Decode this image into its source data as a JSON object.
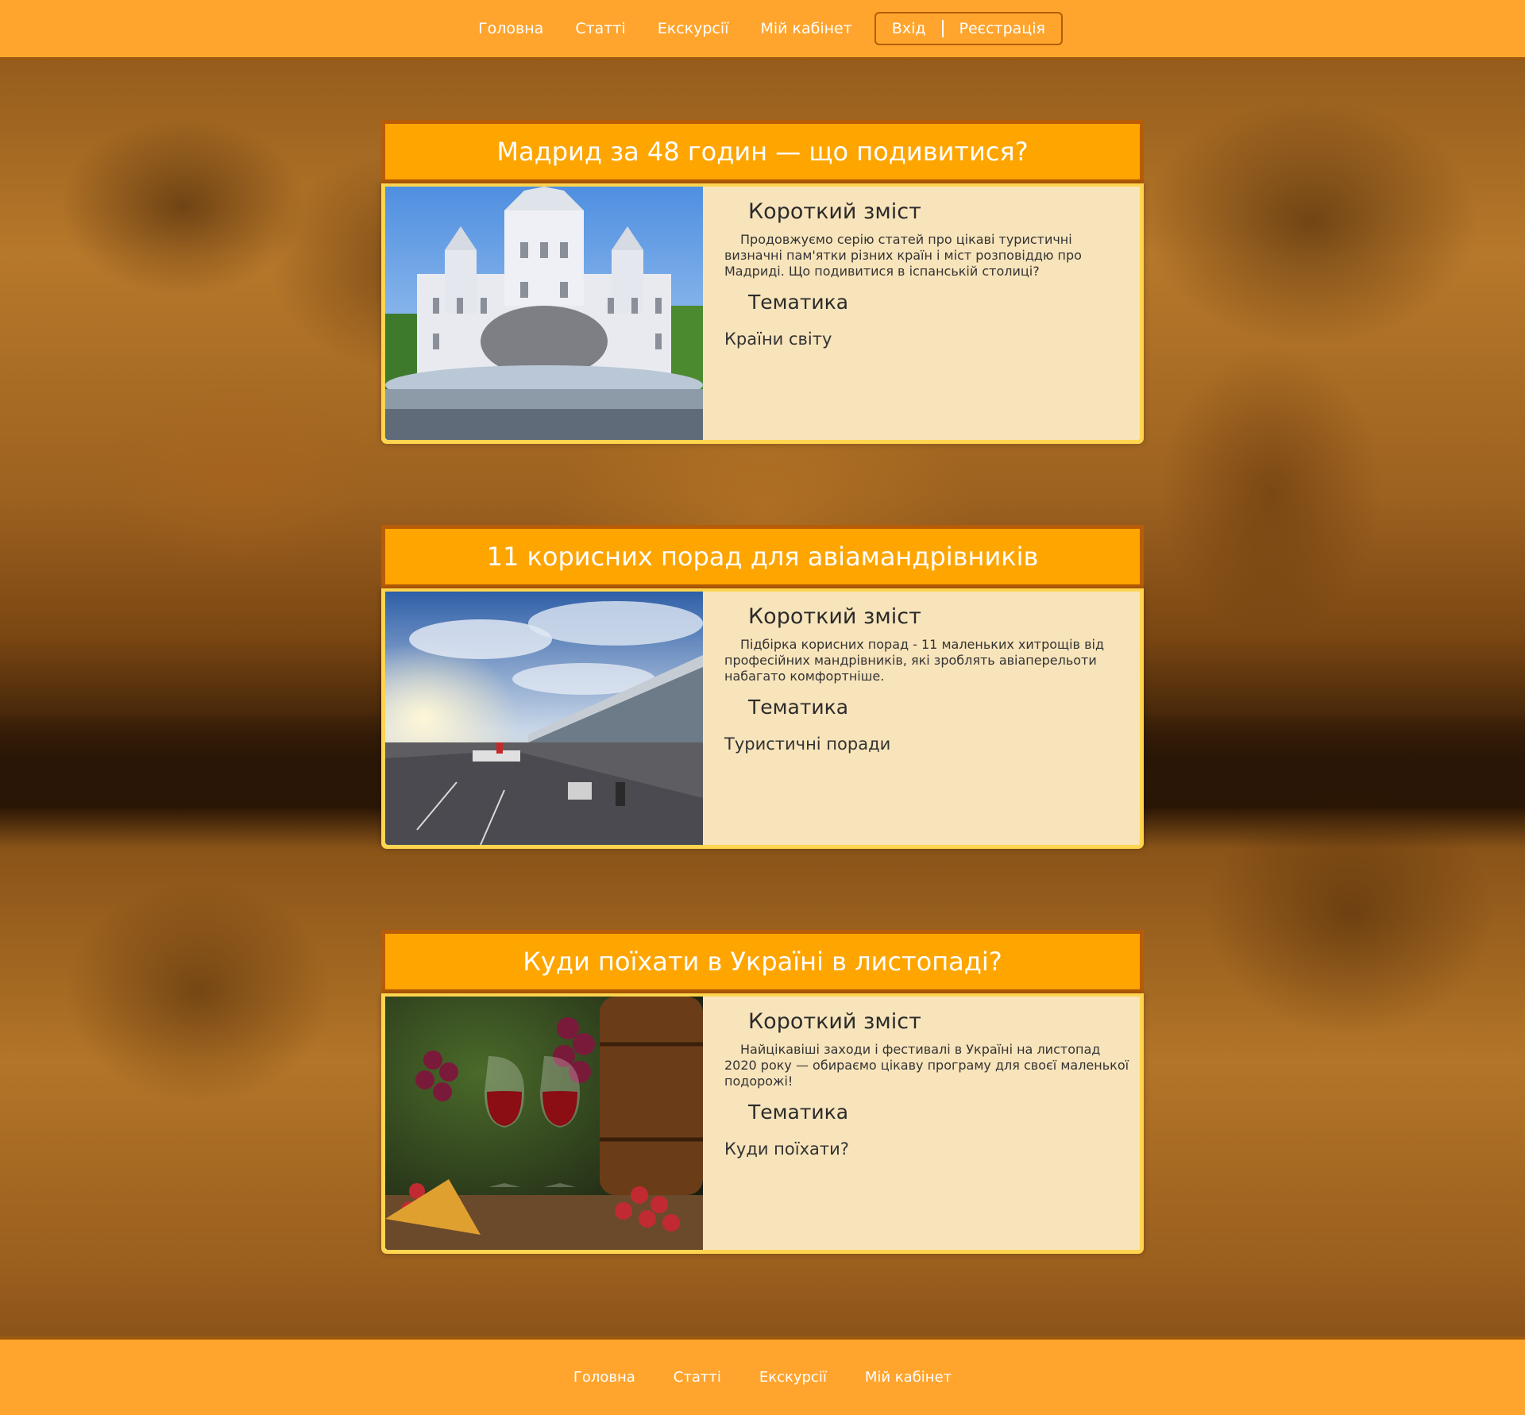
{
  "header": {
    "nav": [
      "Головна",
      "Статті",
      "Екскурсії",
      "Мій кабінет"
    ],
    "login": "Вхід",
    "register": "Реєстрація"
  },
  "articles": [
    {
      "title": "Мадрид за 48 годин — що подивитися?",
      "summary_heading": "Короткий зміст",
      "summary": "Продовжуємо серію статей про цікаві туристичні визначні пам'ятки різних країн і міст розповіддю про Мадриді. Що подивитися в іспанській столиці?",
      "topic_heading": "Тематика",
      "topic": "Країни світу"
    },
    {
      "title": "11 корисних порад для авіамандрівників",
      "summary_heading": "Короткий зміст",
      "summary": "Підбірка корисних порад - 11 маленьких хитрощів від професійних мандрівників, які зроблять авіаперельоти набагато комфортніше.",
      "topic_heading": "Тематика",
      "topic": "Туристичні поради"
    },
    {
      "title": "Куди поїхати в Україні в листопаді?",
      "summary_heading": "Короткий зміст",
      "summary": "Найцікавіші заходи і фестивалі в Україні на листопад 2020 року — обираємо цікаву програму для своєї маленької подорожі!",
      "topic_heading": "Тематика",
      "topic": "Куди поїхати?"
    }
  ],
  "footer": {
    "nav": [
      "Головна",
      "Статті",
      "Екскурсії",
      "Мій кабінет"
    ]
  },
  "colors": {
    "header_bg": "#ffa52e",
    "title_bg": "#ffa500",
    "card_bg": "#f8e4bb",
    "card_border": "#ffd44f"
  }
}
